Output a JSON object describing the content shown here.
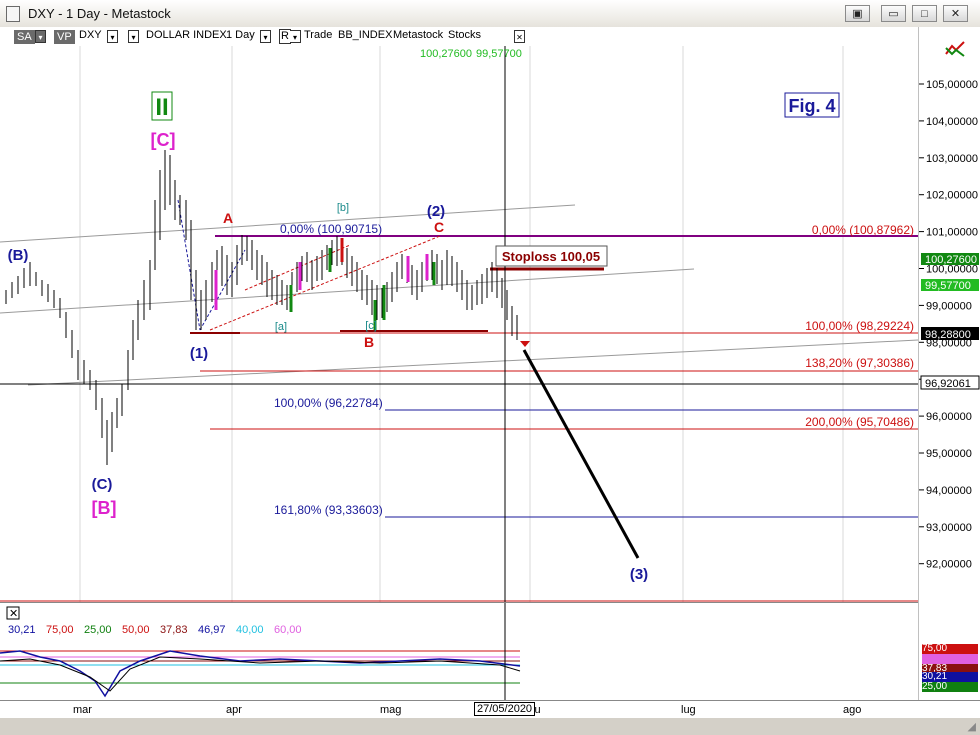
{
  "window": {
    "title": "DXY - 1 Day - Metastock",
    "buttons": [
      "▣",
      "▭",
      "□",
      "✕"
    ]
  },
  "toolbar": {
    "sa": "SA",
    "vp": "VP",
    "symbol": "DXY",
    "name": "DOLLAR INDEX",
    "period": "1 Day",
    "r": "R",
    "trade": "Trade",
    "index": "BB_INDEX",
    "metastock": "Metastock",
    "stocks": "Stocks",
    "close_icon": "✕",
    "quote_high": "100,27600",
    "quote_low": "99,57700"
  },
  "annotations": {
    "fig": "Fig. 4",
    "roman": "II",
    "c_top": "[C]",
    "b_left": "(B)",
    "c_bottom": "(C)",
    "b_bottom": "[B]",
    "wave1": "(1)",
    "wave2": "(2)",
    "wave3": "(3)",
    "a_label": "A",
    "b_label": "B",
    "c_label": "C",
    "b_small": "[b]",
    "a_small": "[a]",
    "c_small": "[c]",
    "stoploss": "Stoploss 100,05"
  },
  "fib": {
    "f0_left": "0,00% (100,90715)",
    "f0_right": "0,00% (100,87962)",
    "f100_right": "100,00% (98,29224)",
    "f138": "138,20% (97,30386)",
    "f100_left": "100,00% (96,22784)",
    "f200": "200,00% (95,70486)",
    "f161": "161,80% (93,33603)"
  },
  "yaxis": {
    "ticks": [
      "105,00000",
      "104,00000",
      "103,00000",
      "102,00000",
      "101,00000",
      "100,00000",
      "99,00000",
      "98,00000",
      "97,00000",
      "96,00000",
      "95,00000",
      "94,00000",
      "93,00000",
      "92,00000"
    ],
    "tags": [
      "100,27600",
      "99,57700",
      "98,28800",
      "96,92061"
    ]
  },
  "indicator": {
    "values": [
      "30,21",
      "75,00",
      "25,00",
      "50,00",
      "37,83",
      "46,97",
      "40,00",
      "60,00"
    ],
    "colors": [
      "#1010a0",
      "#cc1010",
      "#108010",
      "#cc1010",
      "#8a1010",
      "#1010a0",
      "#20c0e0",
      "#e060e0"
    ],
    "tags": [
      "75,00",
      "37,83",
      "30,21",
      "25,00"
    ]
  },
  "xaxis": {
    "months": [
      "mar",
      "apr",
      "mag",
      "lu",
      "lug",
      "ago"
    ],
    "cursor_date": "27/05/2020"
  },
  "colors": {
    "navy": "#1a1a9a",
    "red": "#cc1010",
    "darkred": "#8b0000",
    "magenta": "#dd22cc",
    "green": "#118811",
    "teal": "#1a8a8a"
  }
}
